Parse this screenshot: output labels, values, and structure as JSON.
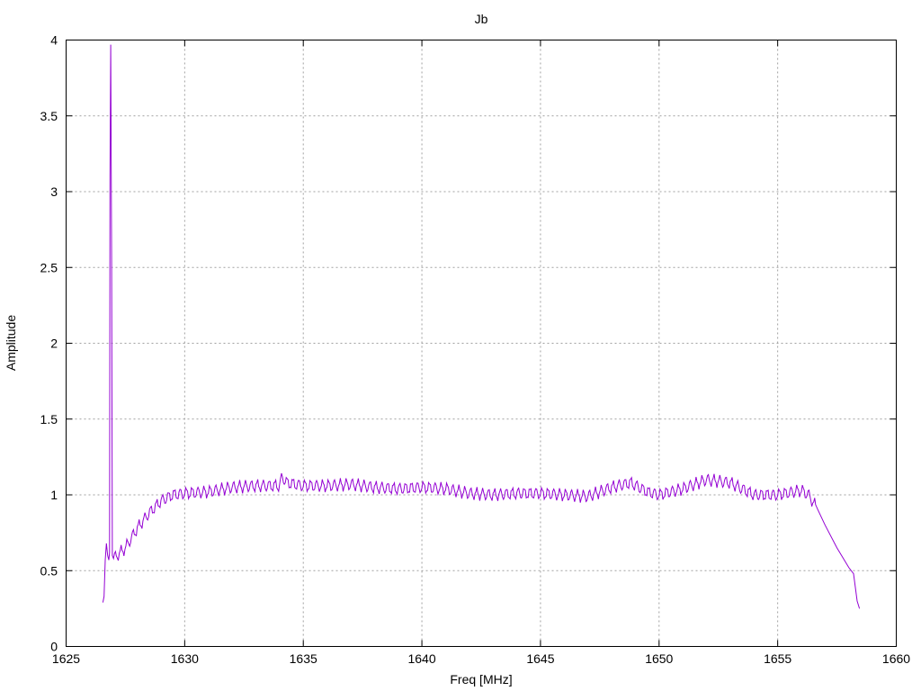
{
  "chart_data": {
    "type": "line",
    "title": "Jb",
    "xlabel": "Freq [MHz]",
    "ylabel": "Amplitude",
    "xlim": [
      1625,
      1660
    ],
    "ylim": [
      0,
      4
    ],
    "xticks": [
      "1625",
      "1630",
      "1635",
      "1640",
      "1645",
      "1650",
      "1655",
      "1660"
    ],
    "yticks": [
      "0",
      "0.5",
      "1",
      "1.5",
      "2",
      "2.5",
      "3",
      "3.5",
      "4"
    ],
    "grid": true,
    "legend": "none",
    "series": [
      {
        "name": "Jb",
        "color": "#9400d3",
        "envelope": [
          [
            1626.55,
            0.29
          ],
          [
            1626.6,
            0.33
          ],
          [
            1626.65,
            0.57
          ],
          [
            1626.7,
            0.68
          ],
          [
            1626.75,
            0.6
          ],
          [
            1626.8,
            0.57
          ],
          [
            1626.83,
            0.62
          ],
          [
            1626.85,
            3.1
          ],
          [
            1626.88,
            3.97
          ],
          [
            1626.92,
            2.55
          ],
          [
            1626.95,
            0.6
          ],
          [
            1627.0,
            0.58
          ],
          [
            1627.5,
            0.65
          ],
          [
            1628,
            0.78
          ],
          [
            1628.5,
            0.88
          ],
          [
            1629,
            0.96
          ],
          [
            1629.5,
            1.0
          ],
          [
            1630,
            1.01
          ],
          [
            1631,
            1.02
          ],
          [
            1632,
            1.05
          ],
          [
            1633,
            1.06
          ],
          [
            1634,
            1.06
          ],
          [
            1634.1,
            1.12
          ],
          [
            1634.3,
            1.08
          ],
          [
            1635,
            1.06
          ],
          [
            1636,
            1.06
          ],
          [
            1637,
            1.07
          ],
          [
            1638,
            1.05
          ],
          [
            1639,
            1.04
          ],
          [
            1640,
            1.05
          ],
          [
            1641,
            1.04
          ],
          [
            1642,
            1.01
          ],
          [
            1643,
            1.0
          ],
          [
            1644,
            1.01
          ],
          [
            1645,
            1.01
          ],
          [
            1646,
            1.0
          ],
          [
            1647,
            0.99
          ],
          [
            1648,
            1.05
          ],
          [
            1648.8,
            1.08
          ],
          [
            1649.5,
            1.02
          ],
          [
            1650,
            1.0
          ],
          [
            1651,
            1.04
          ],
          [
            1652,
            1.1
          ],
          [
            1653,
            1.08
          ],
          [
            1654,
            1.0
          ],
          [
            1655,
            1.0
          ],
          [
            1656,
            1.03
          ],
          [
            1656.3,
            1.0
          ],
          [
            1656.7,
            0.9
          ],
          [
            1657,
            0.8
          ],
          [
            1657.5,
            0.65
          ],
          [
            1658,
            0.52
          ],
          [
            1658.2,
            0.48
          ],
          [
            1658.35,
            0.3
          ],
          [
            1658.45,
            0.25
          ]
        ],
        "ripple": {
          "period_mhz": 0.25,
          "amplitude": 0.035,
          "from": 1627.0,
          "to": 1656.6
        }
      }
    ]
  }
}
